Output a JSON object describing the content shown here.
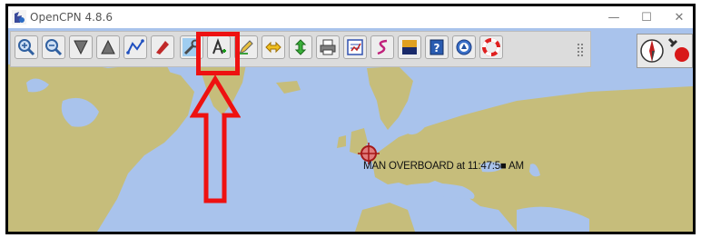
{
  "window": {
    "title": "OpenCPN 4.8.6",
    "controls": {
      "minimize": "—",
      "maximize": "☐",
      "close": "✕"
    }
  },
  "toolbar": {
    "tools": [
      {
        "name": "zoom-in-icon"
      },
      {
        "name": "zoom-out-icon"
      },
      {
        "name": "scale-in-icon"
      },
      {
        "name": "scale-out-icon"
      },
      {
        "name": "route-icon"
      },
      {
        "name": "mark-icon"
      },
      {
        "name": "settings-wrench-icon"
      },
      {
        "name": "text-icon"
      },
      {
        "name": "pen-icon"
      },
      {
        "name": "horizontal-arrows-icon"
      },
      {
        "name": "vertical-arrows-icon"
      },
      {
        "name": "print-icon"
      },
      {
        "name": "route-manager-icon"
      },
      {
        "name": "track-icon"
      },
      {
        "name": "color-scheme-icon"
      },
      {
        "name": "help-icon"
      },
      {
        "name": "ais-icon"
      },
      {
        "name": "mob-icon"
      }
    ]
  },
  "map": {
    "mob_label": "MAN OVERBOARD at 11:47:5■ AM"
  },
  "colors": {
    "sea": "#a9c3ec",
    "land": "#c6bd7b",
    "annotation": "#ee1111"
  }
}
